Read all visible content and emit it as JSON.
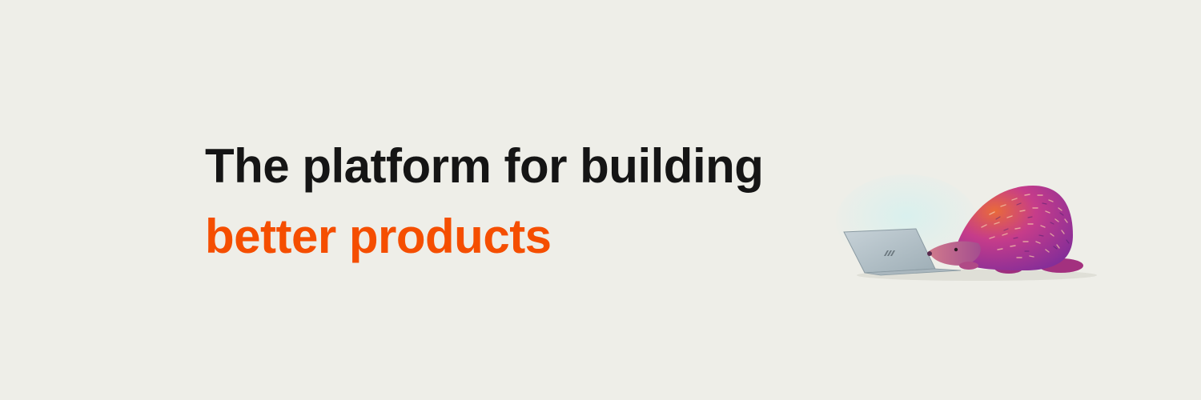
{
  "headline": {
    "line1": "The platform for building",
    "line2": "better products"
  },
  "colors": {
    "background": "#EEEEE8",
    "headline_text": "#151515",
    "accent": "#F54E00",
    "hedgehog_primary": "#B4319E",
    "hedgehog_secondary": "#E96A3A",
    "laptop": "#B8C5CC",
    "screen_glow": "#DDF0EE"
  },
  "illustration": {
    "subject": "hedgehog-with-laptop",
    "icons": [
      "hedgehog-icon",
      "laptop-icon"
    ]
  }
}
